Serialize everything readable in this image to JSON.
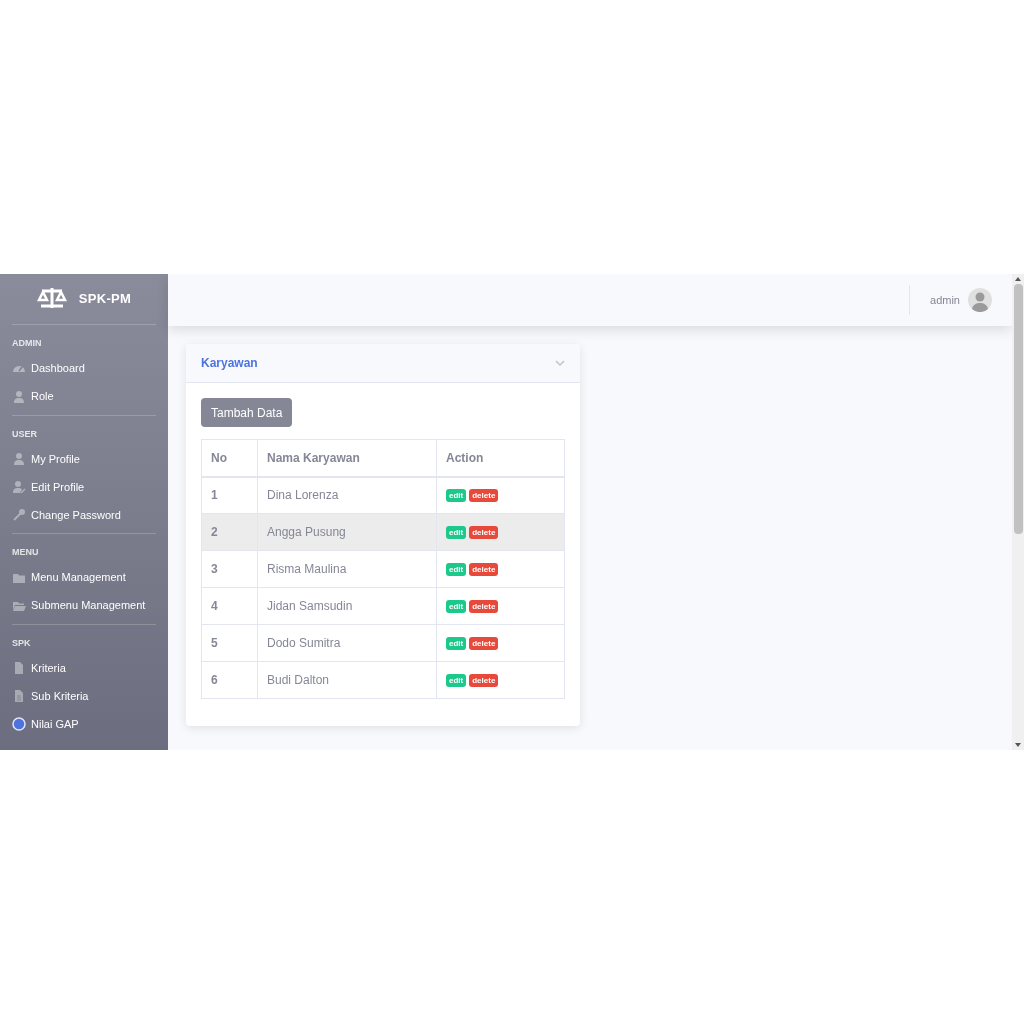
{
  "sidebar": {
    "brand": "SPK-PM",
    "sections": [
      {
        "heading": "ADMIN",
        "items": [
          {
            "label": "Dashboard"
          },
          {
            "label": "Role"
          }
        ]
      },
      {
        "heading": "USER",
        "items": [
          {
            "label": "My Profile"
          },
          {
            "label": "Edit Profile"
          },
          {
            "label": "Change Password"
          }
        ]
      },
      {
        "heading": "MENU",
        "items": [
          {
            "label": "Menu Management"
          },
          {
            "label": "Submenu Management"
          }
        ]
      },
      {
        "heading": "SPK",
        "items": [
          {
            "label": "Kriteria"
          },
          {
            "label": "Sub Kriteria"
          },
          {
            "label": "Nilai GAP"
          }
        ]
      }
    ]
  },
  "topbar": {
    "user": "admin"
  },
  "card": {
    "title": "Karyawan",
    "add_button": "Tambah Data",
    "table": {
      "columns": [
        "No",
        "Nama Karyawan",
        "Action"
      ],
      "rows": [
        {
          "no": "1",
          "name": "Dina Lorenza",
          "highlighted": false,
          "actions": [
            "edit",
            "delete"
          ]
        },
        {
          "no": "2",
          "name": "Angga Pusung",
          "highlighted": true,
          "actions": [
            "edit",
            "delete"
          ]
        },
        {
          "no": "3",
          "name": "Risma Maulina",
          "highlighted": false,
          "actions": [
            "edit",
            "delete"
          ]
        },
        {
          "no": "4",
          "name": "Jidan Samsudin",
          "highlighted": false,
          "actions": [
            "edit",
            "delete"
          ]
        },
        {
          "no": "5",
          "name": "Dodo Sumitra",
          "highlighted": false,
          "actions": [
            "edit",
            "delete"
          ]
        },
        {
          "no": "6",
          "name": "Budi Dalton",
          "highlighted": false,
          "actions": [
            "edit",
            "delete"
          ]
        }
      ]
    }
  }
}
